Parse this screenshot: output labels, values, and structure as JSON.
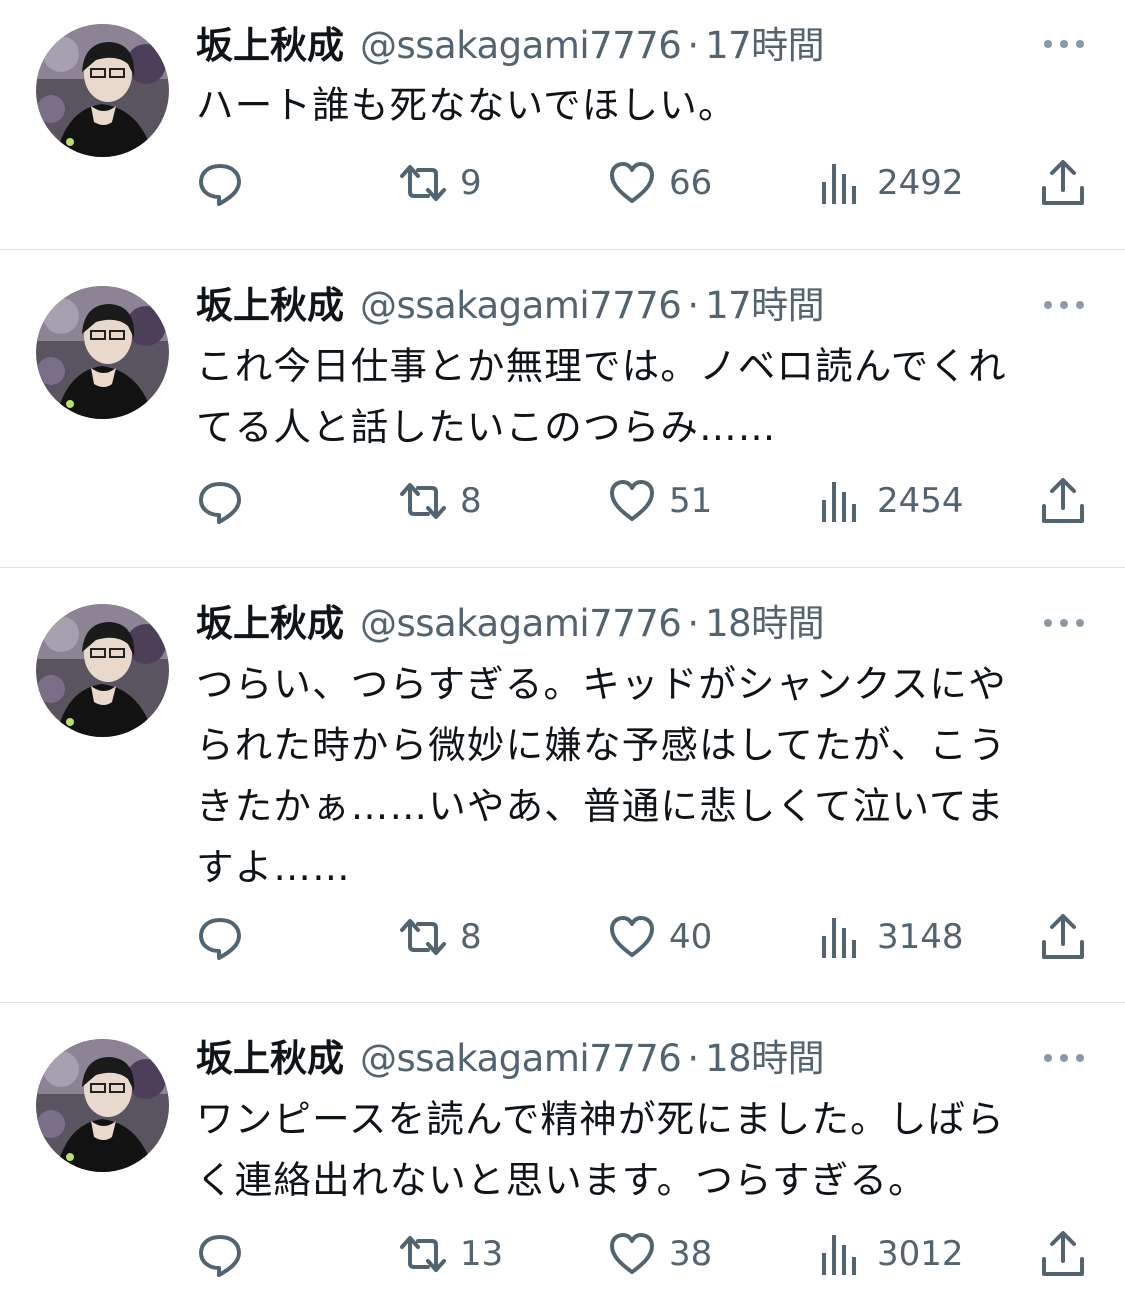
{
  "colors": {
    "text_primary": "#0f1419",
    "text_secondary": "#536471",
    "divider": "#dde2e6",
    "background": "#ffffff"
  },
  "tweets": [
    {
      "name": "坂上秋成",
      "handle": "@ssakagami7776",
      "separator": "·",
      "time": "17時間",
      "text": "ハート誰も死なないでほしい。",
      "replies": "",
      "retweets": "9",
      "likes": "66",
      "views": "2492",
      "icons": [
        "reply-icon",
        "retweet-icon",
        "like-icon",
        "views-icon",
        "share-icon",
        "more-icon"
      ]
    },
    {
      "name": "坂上秋成",
      "handle": "@ssakagami7776",
      "separator": "·",
      "time": "17時間",
      "text": "これ今日仕事とか無理では。ノベロ読んでくれ\nてる人と話したいこのつらみ……",
      "replies": "",
      "retweets": "8",
      "likes": "51",
      "views": "2454",
      "icons": [
        "reply-icon",
        "retweet-icon",
        "like-icon",
        "views-icon",
        "share-icon",
        "more-icon"
      ]
    },
    {
      "name": "坂上秋成",
      "handle": "@ssakagami7776",
      "separator": "·",
      "time": "18時間",
      "text": "つらい、つらすぎる。キッドがシャンクスにや\nられた時から微妙に嫌な予感はしてたが、こう\nきたかぁ……いやあ、普通に悲しくて泣いてま\nすよ……",
      "replies": "",
      "retweets": "8",
      "likes": "40",
      "views": "3148",
      "icons": [
        "reply-icon",
        "retweet-icon",
        "like-icon",
        "views-icon",
        "share-icon",
        "more-icon"
      ]
    },
    {
      "name": "坂上秋成",
      "handle": "@ssakagami7776",
      "separator": "·",
      "time": "18時間",
      "text": "ワンピースを読んで精神が死にました。しばら\nく連絡出れないと思います。つらすぎる。",
      "replies": "",
      "retweets": "13",
      "likes": "38",
      "views": "3012",
      "icons": [
        "reply-icon",
        "retweet-icon",
        "like-icon",
        "views-icon",
        "share-icon",
        "more-icon"
      ]
    }
  ]
}
